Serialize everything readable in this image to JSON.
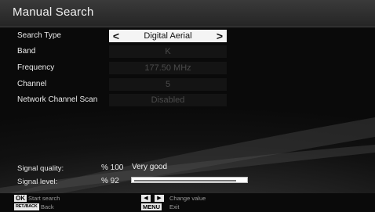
{
  "header": {
    "title": "Manual Search"
  },
  "settings": [
    {
      "label": "Search Type",
      "value": "Digital Aerial",
      "active": true
    },
    {
      "label": "Band",
      "value": "K",
      "active": false
    },
    {
      "label": "Frequency",
      "value": "177.50 MHz",
      "active": false
    },
    {
      "label": "Channel",
      "value": "5",
      "active": false
    },
    {
      "label": "Network Channel Scan",
      "value": "Disabled",
      "active": false
    }
  ],
  "signal": {
    "quality_label": "Signal quality:",
    "quality_value": "% 100",
    "quality_text": "Very good",
    "level_label": "Signal level:",
    "level_value": "% 92",
    "level_fraction": 0.92
  },
  "footer": {
    "ok_key": "OK",
    "ok_action": "Start search",
    "back_key": "RET./BACK",
    "back_action": "Back",
    "nav_left_glyph": "◀",
    "nav_right_glyph": "▶",
    "nav_action": "Change value",
    "menu_key": "MENU",
    "menu_action": "Exit"
  },
  "icons": {
    "prev": "chevron-left-icon",
    "next": "chevron-right-icon"
  },
  "colors": {
    "highlight": "#f4f4f4",
    "background": "#111111"
  }
}
